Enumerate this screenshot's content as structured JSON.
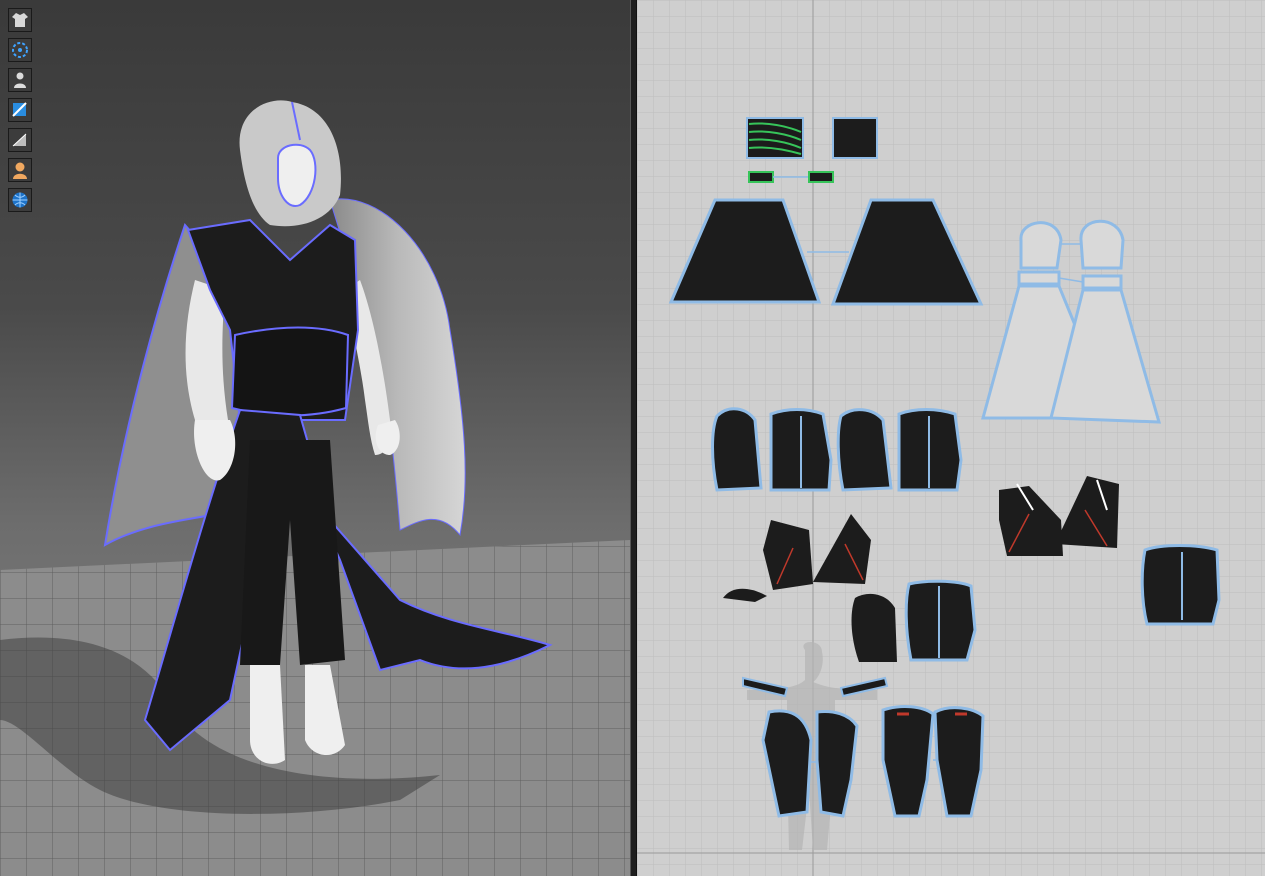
{
  "app": {
    "views": {
      "viewport_3d": {
        "background": "#4a4a4a"
      },
      "pattern_2d": {
        "background": "#cfcfcf",
        "grid_color": "#b9b9b9"
      }
    },
    "colors": {
      "garment_black": "#1c1c1c",
      "selection_outline": "#6a6cff",
      "pattern_outline": "#8fbbe6",
      "cape_gray": "#c4c4c4",
      "avatar_white": "#efefef",
      "stitch_green": "#37c45a",
      "dart_red": "#c0392b"
    }
  },
  "toolbar": {
    "tools": [
      {
        "name": "garment-tool",
        "icon": "shirt-icon"
      },
      {
        "name": "simulation-tool",
        "icon": "particles-icon"
      },
      {
        "name": "avatar-tool",
        "icon": "person-icon"
      },
      {
        "name": "fabric-tool",
        "icon": "fabric-icon"
      },
      {
        "name": "texture-tool",
        "icon": "texture-icon"
      },
      {
        "name": "avatar-skin-tool",
        "icon": "avatar-skin-icon"
      },
      {
        "name": "environment-tool",
        "icon": "globe-icon"
      }
    ]
  }
}
